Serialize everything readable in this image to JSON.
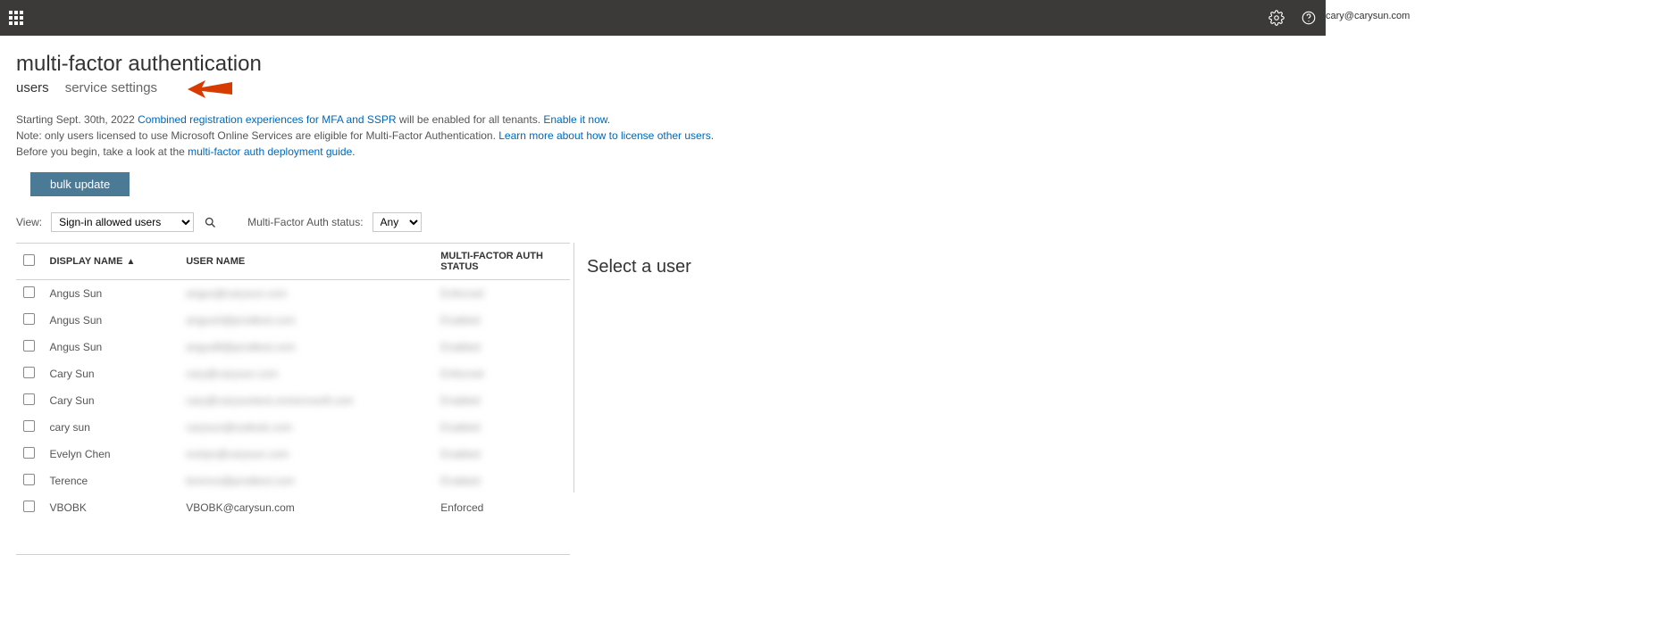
{
  "topbar": {
    "account": "cary@carysun.com"
  },
  "page": {
    "title": "multi-factor authentication",
    "tabs": {
      "users": "users",
      "service_settings": "service settings"
    },
    "notice": {
      "line1_pre": "Starting Sept. 30th, 2022 ",
      "line1_link": "Combined registration experiences for MFA and SSPR",
      "line1_mid": " will be enabled for all tenants. ",
      "line1_link2": "Enable it now.",
      "line2_pre": "Note: only users licensed to use Microsoft Online Services are eligible for Multi-Factor Authentication. ",
      "line2_link": "Learn more about how to license other users.",
      "line3_pre": "Before you begin, take a look at the ",
      "line3_link": "multi-factor auth deployment guide."
    },
    "bulk_update": "bulk update",
    "filters": {
      "view_label": "View:",
      "view_value": "Sign-in allowed users",
      "status_label": "Multi-Factor Auth status:",
      "status_value": "Any"
    },
    "table": {
      "col_display_name": "DISPLAY NAME",
      "col_user_name": "USER NAME",
      "col_status": "MULTI-FACTOR AUTH STATUS",
      "rows": [
        {
          "display": "Angus Sun",
          "user": "angus@carysun.com",
          "status": "Enforced",
          "blur": true
        },
        {
          "display": "Angus Sun",
          "user": "angusA@prodtest.com",
          "status": "Enabled",
          "blur": true
        },
        {
          "display": "Angus Sun",
          "user": "angusB@prodtest.com",
          "status": "Enabled",
          "blur": true
        },
        {
          "display": "Cary Sun",
          "user": "cary@carysun.com",
          "status": "Enforced",
          "blur": true
        },
        {
          "display": "Cary Sun",
          "user": "cary@carysuntest.onmicrosoft.com",
          "status": "Enabled",
          "blur": true
        },
        {
          "display": "cary sun",
          "user": "carysun@outlook.com",
          "status": "Enabled",
          "blur": true
        },
        {
          "display": "Evelyn Chen",
          "user": "evelyn@carysun.com",
          "status": "Enabled",
          "blur": true
        },
        {
          "display": "Terence",
          "user": "terence@prodtest.com",
          "status": "Enabled",
          "blur": true
        },
        {
          "display": "VBOBK",
          "user": "VBOBK@carysun.com",
          "status": "Enforced",
          "blur": false
        }
      ]
    },
    "side_panel_title": "Select a user"
  }
}
